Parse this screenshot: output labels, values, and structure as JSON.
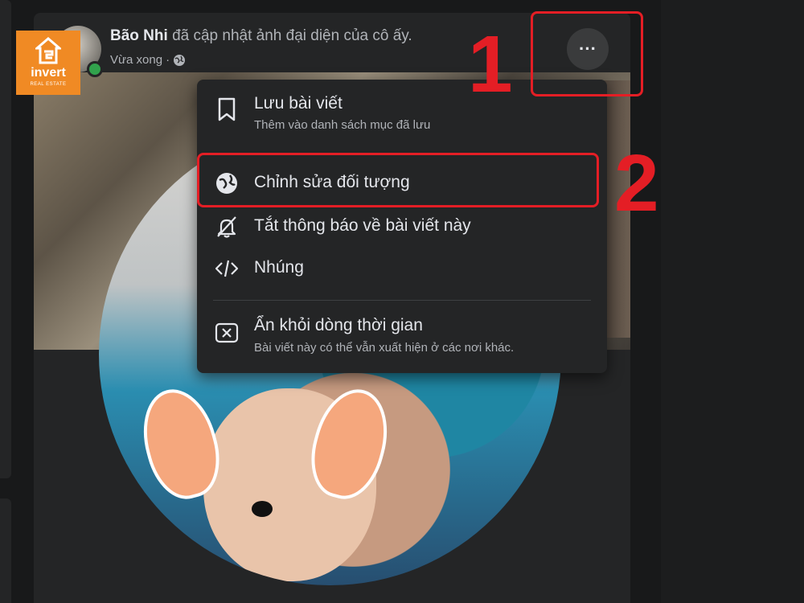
{
  "logo": {
    "brand": "invert",
    "sub": "REAL ESTATE"
  },
  "post": {
    "author": "Bão Nhi",
    "action": "đã cập nhật ảnh đại diện của cô ấy.",
    "time": "Vừa xong",
    "separator": "·",
    "more_icon": "···"
  },
  "menu": {
    "items": [
      {
        "icon": "bookmark-icon",
        "title": "Lưu bài viết",
        "subtitle": "Thêm vào danh sách mục đã lưu"
      },
      {
        "icon": "globe-icon",
        "title": "Chỉnh sửa đối tượng"
      },
      {
        "icon": "bell-off-icon",
        "title": "Tắt thông báo về bài viết này"
      },
      {
        "icon": "code-icon",
        "title": "Nhúng"
      },
      {
        "icon": "close-box-icon",
        "title": "Ẩn khỏi dòng thời gian",
        "subtitle": "Bài viết này có thể vẫn xuất hiện ở các nơi khác."
      }
    ]
  },
  "annotations": {
    "step1": "1",
    "step2": "2",
    "color": "#e41e25"
  },
  "colors": {
    "background": "#18191a",
    "card": "#242526",
    "text": "#e4e6eb",
    "muted": "#b0b3b8",
    "online": "#31a24c",
    "logo": "#f08a24"
  }
}
